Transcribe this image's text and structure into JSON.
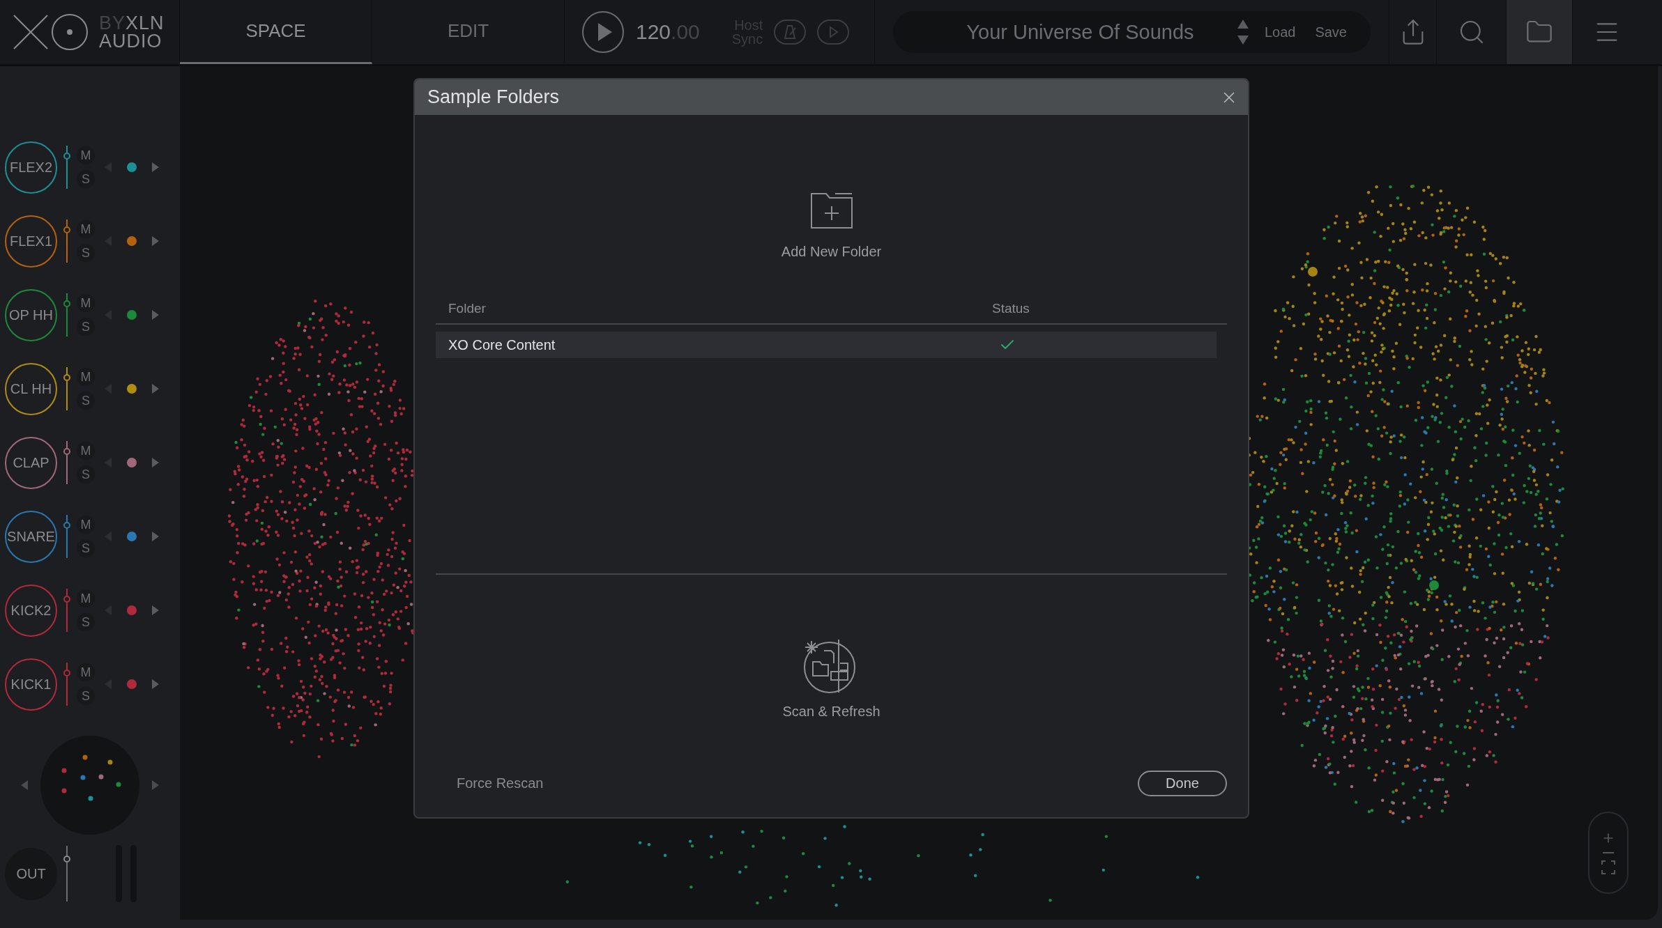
{
  "logo": {
    "by": "BY",
    "brand": "XLN",
    "sub": "AUDIO"
  },
  "tabs": [
    {
      "label": "SPACE",
      "selected": true
    },
    {
      "label": "EDIT",
      "selected": false
    }
  ],
  "transport": {
    "tempo": "120",
    "tempo_decimals": ".00",
    "host_sync": [
      "Host",
      "Sync"
    ]
  },
  "preset": {
    "name": "Your Universe Of Sounds",
    "load": "Load",
    "save": "Save"
  },
  "toolbar": [
    {
      "kind": "share",
      "selected": false
    },
    {
      "kind": "search",
      "selected": false
    },
    {
      "kind": "folder",
      "selected": true
    },
    {
      "kind": "menu",
      "selected": false
    }
  ],
  "tracks": [
    {
      "name": "FLEX2",
      "color": "#1b9096",
      "level": 0.8,
      "mute": "M",
      "solo": "S"
    },
    {
      "name": "FLEX1",
      "color": "#b5620f",
      "level": 0.8,
      "mute": "M",
      "solo": "S"
    },
    {
      "name": "OP HH",
      "color": "#1c8a3a",
      "level": 0.8,
      "mute": "M",
      "solo": "S"
    },
    {
      "name": "CL HH",
      "color": "#b08d12",
      "level": 0.8,
      "mute": "M",
      "solo": "S"
    },
    {
      "name": "CLAP",
      "color": "#a06878",
      "level": 0.8,
      "mute": "M",
      "solo": "S"
    },
    {
      "name": "SNARE",
      "color": "#2a78b0",
      "level": 0.8,
      "mute": "M",
      "solo": "S"
    },
    {
      "name": "KICK2",
      "color": "#b02a3c",
      "level": 0.8,
      "mute": "M",
      "solo": "S"
    },
    {
      "name": "KICK1",
      "color": "#b02a3c",
      "level": 0.8,
      "mute": "M",
      "solo": "S"
    }
  ],
  "output": {
    "label": "OUT",
    "level": 0.8
  },
  "dialog": {
    "title": "Sample Folders",
    "add_label": "Add New Folder",
    "columns": [
      "Folder",
      "Status"
    ],
    "rows": [
      {
        "name": "XO Core Content",
        "ok": true,
        "selected": true
      }
    ],
    "scan_label": "Scan & Refresh",
    "force_rescan": "Force Rescan",
    "done": "Done"
  }
}
